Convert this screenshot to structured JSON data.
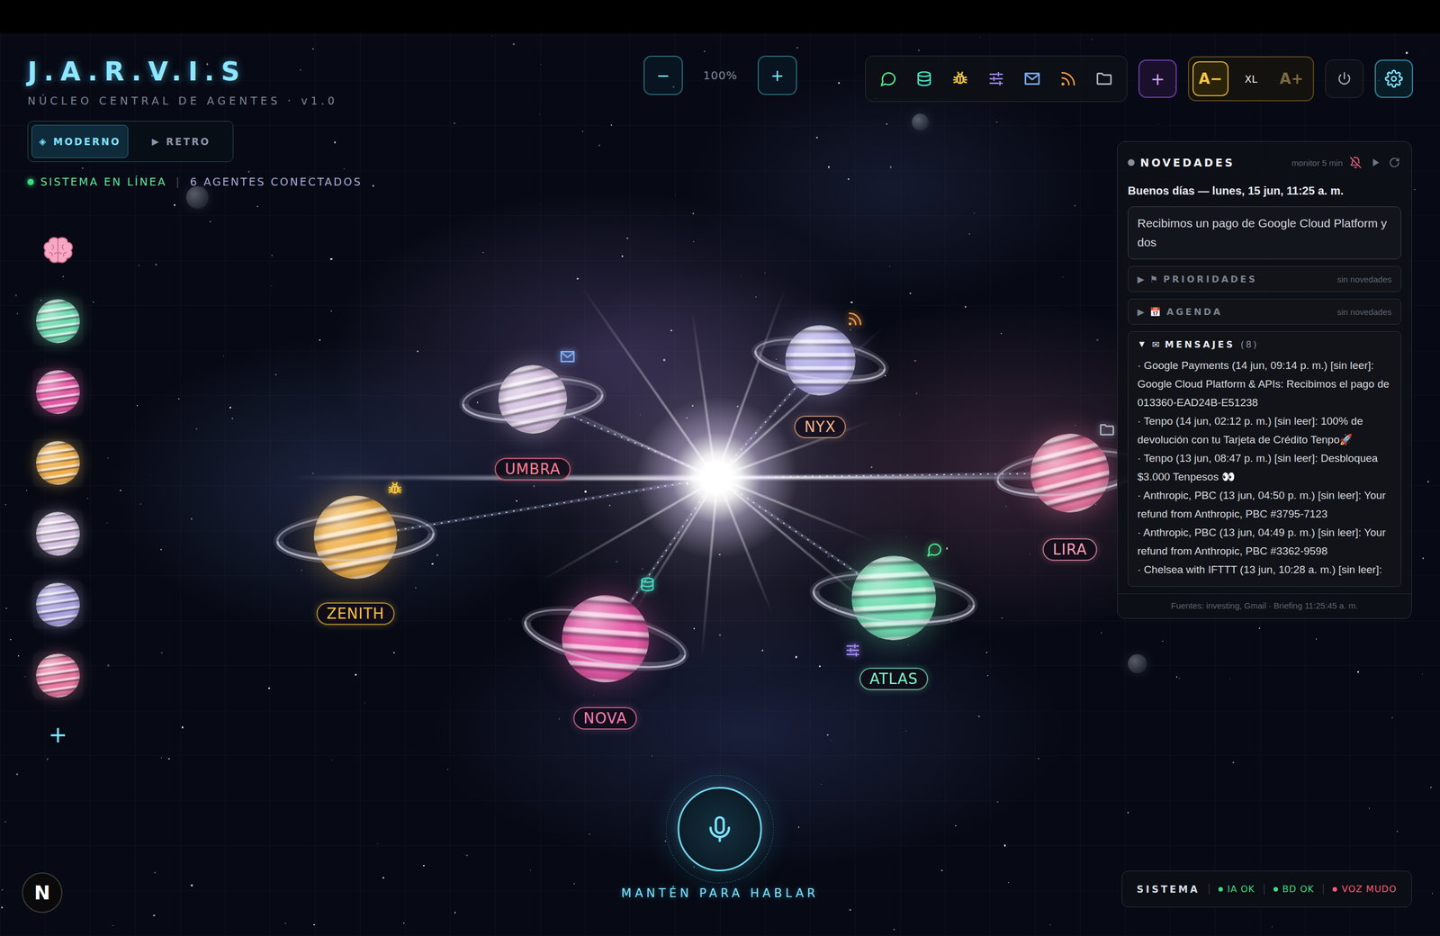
{
  "header": {
    "title": "J.A.R.V.I.S",
    "subtitle": "NÚCLEO CENTRAL DE AGENTES · v1.0"
  },
  "modes": [
    {
      "icon": "◈",
      "label": "MODERNO",
      "selected": true
    },
    {
      "icon": "▶",
      "label": "RETRO",
      "selected": false
    }
  ],
  "status": {
    "online": "SISTEMA EN LÍNEA",
    "separator": "|",
    "agents": "6 AGENTES CONECTADOS"
  },
  "zoom": {
    "minus": "−",
    "value": "100%",
    "plus": "+"
  },
  "add_agent": "+",
  "font_size": [
    {
      "label": "A−",
      "selected": true,
      "disabled": false
    },
    {
      "label": "XL",
      "selected": false,
      "disabled": false
    },
    {
      "label": "A+",
      "selected": false,
      "disabled": true
    }
  ],
  "sidebar": {
    "items": [
      {
        "color": "#6fdcb0"
      },
      {
        "color": "#e45aa6"
      },
      {
        "color": "#efb24e"
      },
      {
        "color": "#d6c2e0"
      },
      {
        "color": "#a9a3de"
      },
      {
        "color": "#e87a9f"
      }
    ],
    "add": "+"
  },
  "agents": [
    {
      "name": "UMBRA",
      "color": "#d6c2e0",
      "accent": "#ff7f98"
    },
    {
      "name": "NYX",
      "color": "#b3aee6",
      "accent": "#f2b48e"
    },
    {
      "name": "ZENITH",
      "color": "#efb24e",
      "accent": "#f5c542"
    },
    {
      "name": "NOVA",
      "color": "#e45aa6",
      "accent": "#ff7db8"
    },
    {
      "name": "ATLAS",
      "color": "#6fdcb0",
      "accent": "#7ff2c4"
    },
    {
      "name": "LIRA",
      "color": "#e87a9f",
      "accent": "#ff9fb8"
    }
  ],
  "voice": {
    "label": "MANTÉN PARA HABLAR"
  },
  "news": {
    "title": "NOVEDADES",
    "monitor": "monitor 5 min",
    "greeting": "Buenos días — lunes, 15 jun, 11:25 a. m.",
    "summary": "Recibimos un pago de Google Cloud Platform y dos",
    "sections": [
      {
        "arrow": "▶",
        "icon": "⚑",
        "title": "PRIORIDADES",
        "note": "sin novedades",
        "expanded": false
      },
      {
        "arrow": "▶",
        "icon": "📅",
        "title": "AGENDA",
        "note": "sin novedades",
        "expanded": false
      },
      {
        "arrow": "▼",
        "icon": "✉",
        "title": "MENSAJES",
        "count": "(8)",
        "expanded": true,
        "items": [
          "· Google Payments (14 jun, 09:14 p. m.) [sin leer]: Google Cloud Platform & APIs: Recibimos el pago de 013360-EAD24B-E51238",
          "· Tenpo (14 jun, 02:12 p. m.) [sin leer]: 100% de devolución con tu Tarjeta de Crédito Tenpo🚀",
          "· Tenpo (13 jun, 08:47 p. m.) [sin leer]: Desbloquea $3.000 Tenpesos 👀",
          "· Anthropic, PBC (13 jun, 04:50 p. m.) [sin leer]: Your refund from Anthropic, PBC #3795-7123",
          "· Anthropic, PBC (13 jun, 04:49 p. m.) [sin leer]: Your refund from Anthropic, PBC #3362-9598",
          "· Chelsea with IFTTT (13 jun, 10:28 a. m.) [sin leer]:"
        ]
      }
    ],
    "footer": "Fuentes: investing, Gmail · Briefing 11:25:45 a. m."
  },
  "system": {
    "title": "SISTEMA",
    "items": [
      {
        "label": "IA OK",
        "color": "#3ddc84"
      },
      {
        "label": "BD OK",
        "color": "#3ddc84"
      },
      {
        "label": "VOZ MUDO",
        "color": "#ff5a78"
      }
    ]
  },
  "logo": "N"
}
